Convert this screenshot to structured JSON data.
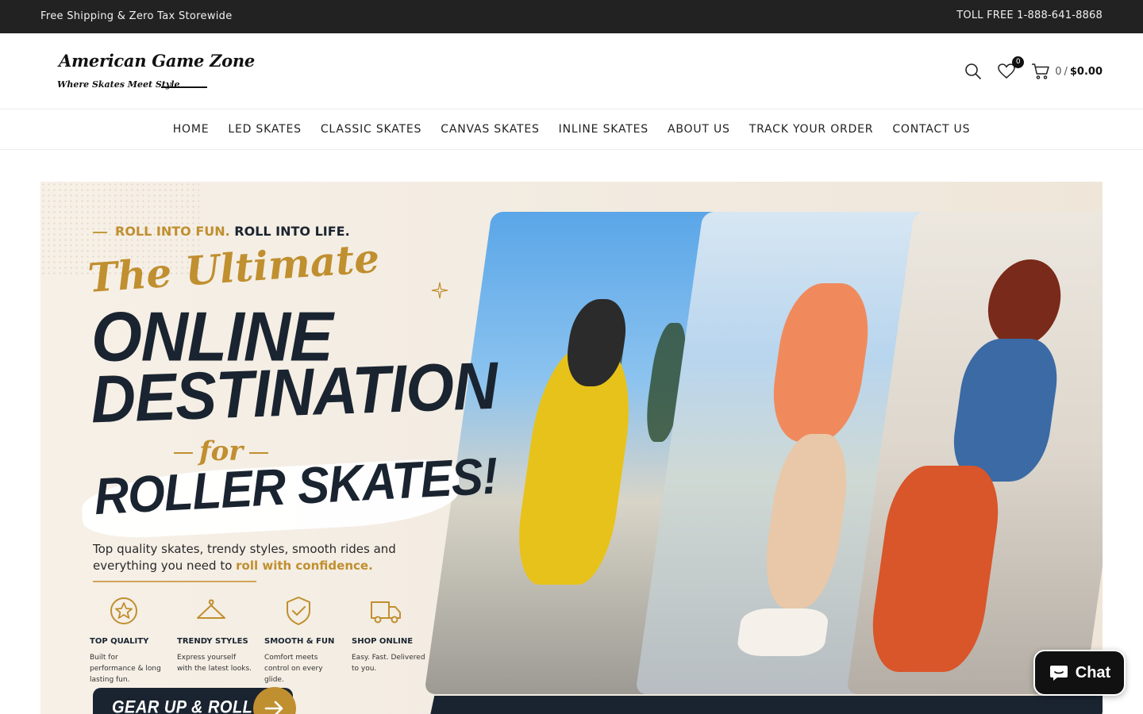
{
  "topbar": {
    "promo": "Free Shipping & Zero Tax Storewide",
    "phone": "TOLL FREE 1-888-641-8868"
  },
  "header": {
    "logo_title": "American Game Zone",
    "logo_subtitle": "Where Skates Meet Style",
    "wishlist_count": "0",
    "cart_count": "0",
    "cart_separator": "/",
    "cart_total": "$0.00",
    "icons": [
      "search-icon",
      "heart-icon",
      "cart-icon"
    ]
  },
  "nav": {
    "items": [
      {
        "label": "HOME"
      },
      {
        "label": "LED SKATES"
      },
      {
        "label": "CLASSIC SKATES"
      },
      {
        "label": "CANVAS SKATES"
      },
      {
        "label": "INLINE SKATES"
      },
      {
        "label": "ABOUT US"
      },
      {
        "label": "TRACK YOUR ORDER"
      },
      {
        "label": "CONTACT US"
      }
    ]
  },
  "hero": {
    "tagline_gold": "ROLL INTO FUN.",
    "tagline_dark": "ROLL INTO LIFE.",
    "headline_script": "The Ultimate",
    "headline_line1": "ONLINE",
    "headline_line2": "DESTINATION",
    "headline_for": "for",
    "headline_line3": "ROLLER SKATES!",
    "description_main": "Top quality skates, trendy styles, smooth rides and everything you need to ",
    "description_highlight": "roll with confidence.",
    "features": [
      {
        "icon": "star-badge-icon",
        "title": "TOP QUALITY",
        "desc": "Built for performance & long lasting fun."
      },
      {
        "icon": "hanger-icon",
        "title": "TRENDY STYLES",
        "desc": "Express yourself with the latest looks."
      },
      {
        "icon": "shield-check-icon",
        "title": "SMOOTH & FUN",
        "desc": "Comfort meets control on every glide."
      },
      {
        "icon": "truck-icon",
        "title": "SHOP ONLINE",
        "desc": "Easy. Fast. Delivered to you."
      }
    ],
    "cta_label": "GEAR UP & ROLL ON",
    "colors": {
      "gold": "#c08f2f",
      "navy": "#1a2430",
      "cream": "#f3ece2"
    }
  },
  "chat": {
    "label": "Chat"
  }
}
